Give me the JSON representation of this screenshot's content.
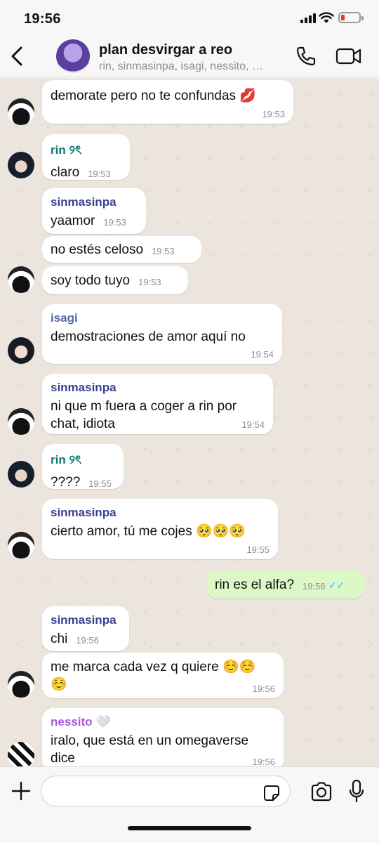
{
  "status": {
    "time": "19:56"
  },
  "header": {
    "title": "plan desvirgar a reo",
    "subtitle": "rin, sinmasinpa, isagi, nessito, …"
  },
  "messages": [
    {
      "text": "demorate pero no te confundas 💋",
      "time": "19:53"
    },
    {
      "sender": "rin ୨ৎ",
      "text": "claro",
      "time": "19:53"
    },
    {
      "sender": "sinmasinpa",
      "text": "yaamor",
      "time": "19:53"
    },
    {
      "text": "no estés celoso",
      "time": "19:53"
    },
    {
      "text": "soy todo tuyo",
      "time": "19:53"
    },
    {
      "sender": "isagi",
      "text": "demostraciones de amor aquí no",
      "time": "19:54"
    },
    {
      "sender": "sinmasinpa",
      "line1": "ni que m fuera a coger a rin por",
      "line2": "chat, idiota",
      "time": "19:54"
    },
    {
      "sender": "rin ୨ৎ",
      "text": "????",
      "time": "19:55"
    },
    {
      "sender": "sinmasinpa",
      "text": "cierto amor, tú me cojes 🥺🥺🥺",
      "time": "19:55"
    },
    {
      "text": "rin es el alfa?",
      "time": "19:56",
      "ticks": "✓✓"
    },
    {
      "sender": "sinmasinpa",
      "text": "chi",
      "time": "19:56"
    },
    {
      "line1": "me marca cada vez q quiere ☺️☺️",
      "line2": "☺️",
      "time": "19:56"
    },
    {
      "sender": "nessito 🤍",
      "line1": "iralo, que está en un omegaverse",
      "line2": "dice",
      "time": "19:56"
    }
  ],
  "composer": {
    "placeholder": ""
  }
}
